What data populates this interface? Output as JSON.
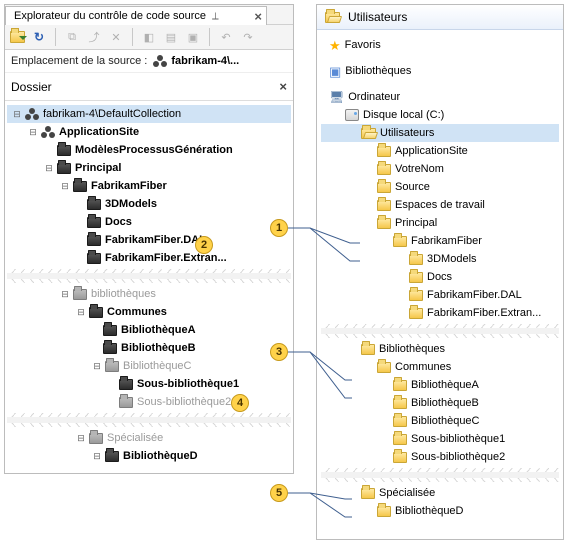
{
  "left": {
    "tab_title": "Explorateur du contrôle de code source",
    "toolbar_icons": [
      "open",
      "refresh",
      "sep",
      "copy",
      "cut",
      "delete",
      "sep",
      "compare",
      "history",
      "sep",
      "undo",
      "redo"
    ],
    "location_label": "Emplacement de la source :",
    "location_value": "fabrikam-4\\...",
    "folder_header": "Dossier",
    "tree": {
      "root": "fabrikam-4\\DefaultCollection",
      "site": "ApplicationSite",
      "modeles": "ModèlesProcessusGénération",
      "principal": "Principal",
      "fabrikam": "FabrikamFiber",
      "models3d": "3DModels",
      "docs": "Docs",
      "dal": "FabrikamFiber.DAL",
      "extran": "FabrikamFiber.Extran...",
      "biblio": "bibliothèques",
      "communes": "Communes",
      "bibA": "BibliothèqueA",
      "bibB": "BibliothèqueB",
      "bibC": "BibliothèqueC",
      "sub1": "Sous-bibliothèque1",
      "sub2": "Sous-bibliothèque2",
      "spec": "Spécialisée",
      "bibD": "BibliothèqueD"
    }
  },
  "right": {
    "header": "Utilisateurs",
    "favoris": "Favoris",
    "bibliotheques": "Bibliothèques",
    "ordinateur": "Ordinateur",
    "disque": "Disque local (C:)",
    "utilisateurs": "Utilisateurs",
    "appsite": "ApplicationSite",
    "votrenom": "VotreNom",
    "source": "Source",
    "espaces": "Espaces de travail",
    "principal": "Principal",
    "fabrikam": "FabrikamFiber",
    "models3d": "3DModels",
    "docs": "Docs",
    "dal": "FabrikamFiber.DAL",
    "extran": "FabrikamFiber.Extran...",
    "bibliotheques2": "Bibliothèques",
    "communes": "Communes",
    "bibA": "BibliothèqueA",
    "bibB": "BibliothèqueB",
    "bibC": "BibliothèqueC",
    "sub1": "Sous-bibliothèque1",
    "sub2": "Sous-bibliothèque2",
    "spec": "Spécialisée",
    "bibD": "BibliothèqueD"
  },
  "badges": [
    "1",
    "2",
    "3",
    "4",
    "5"
  ]
}
